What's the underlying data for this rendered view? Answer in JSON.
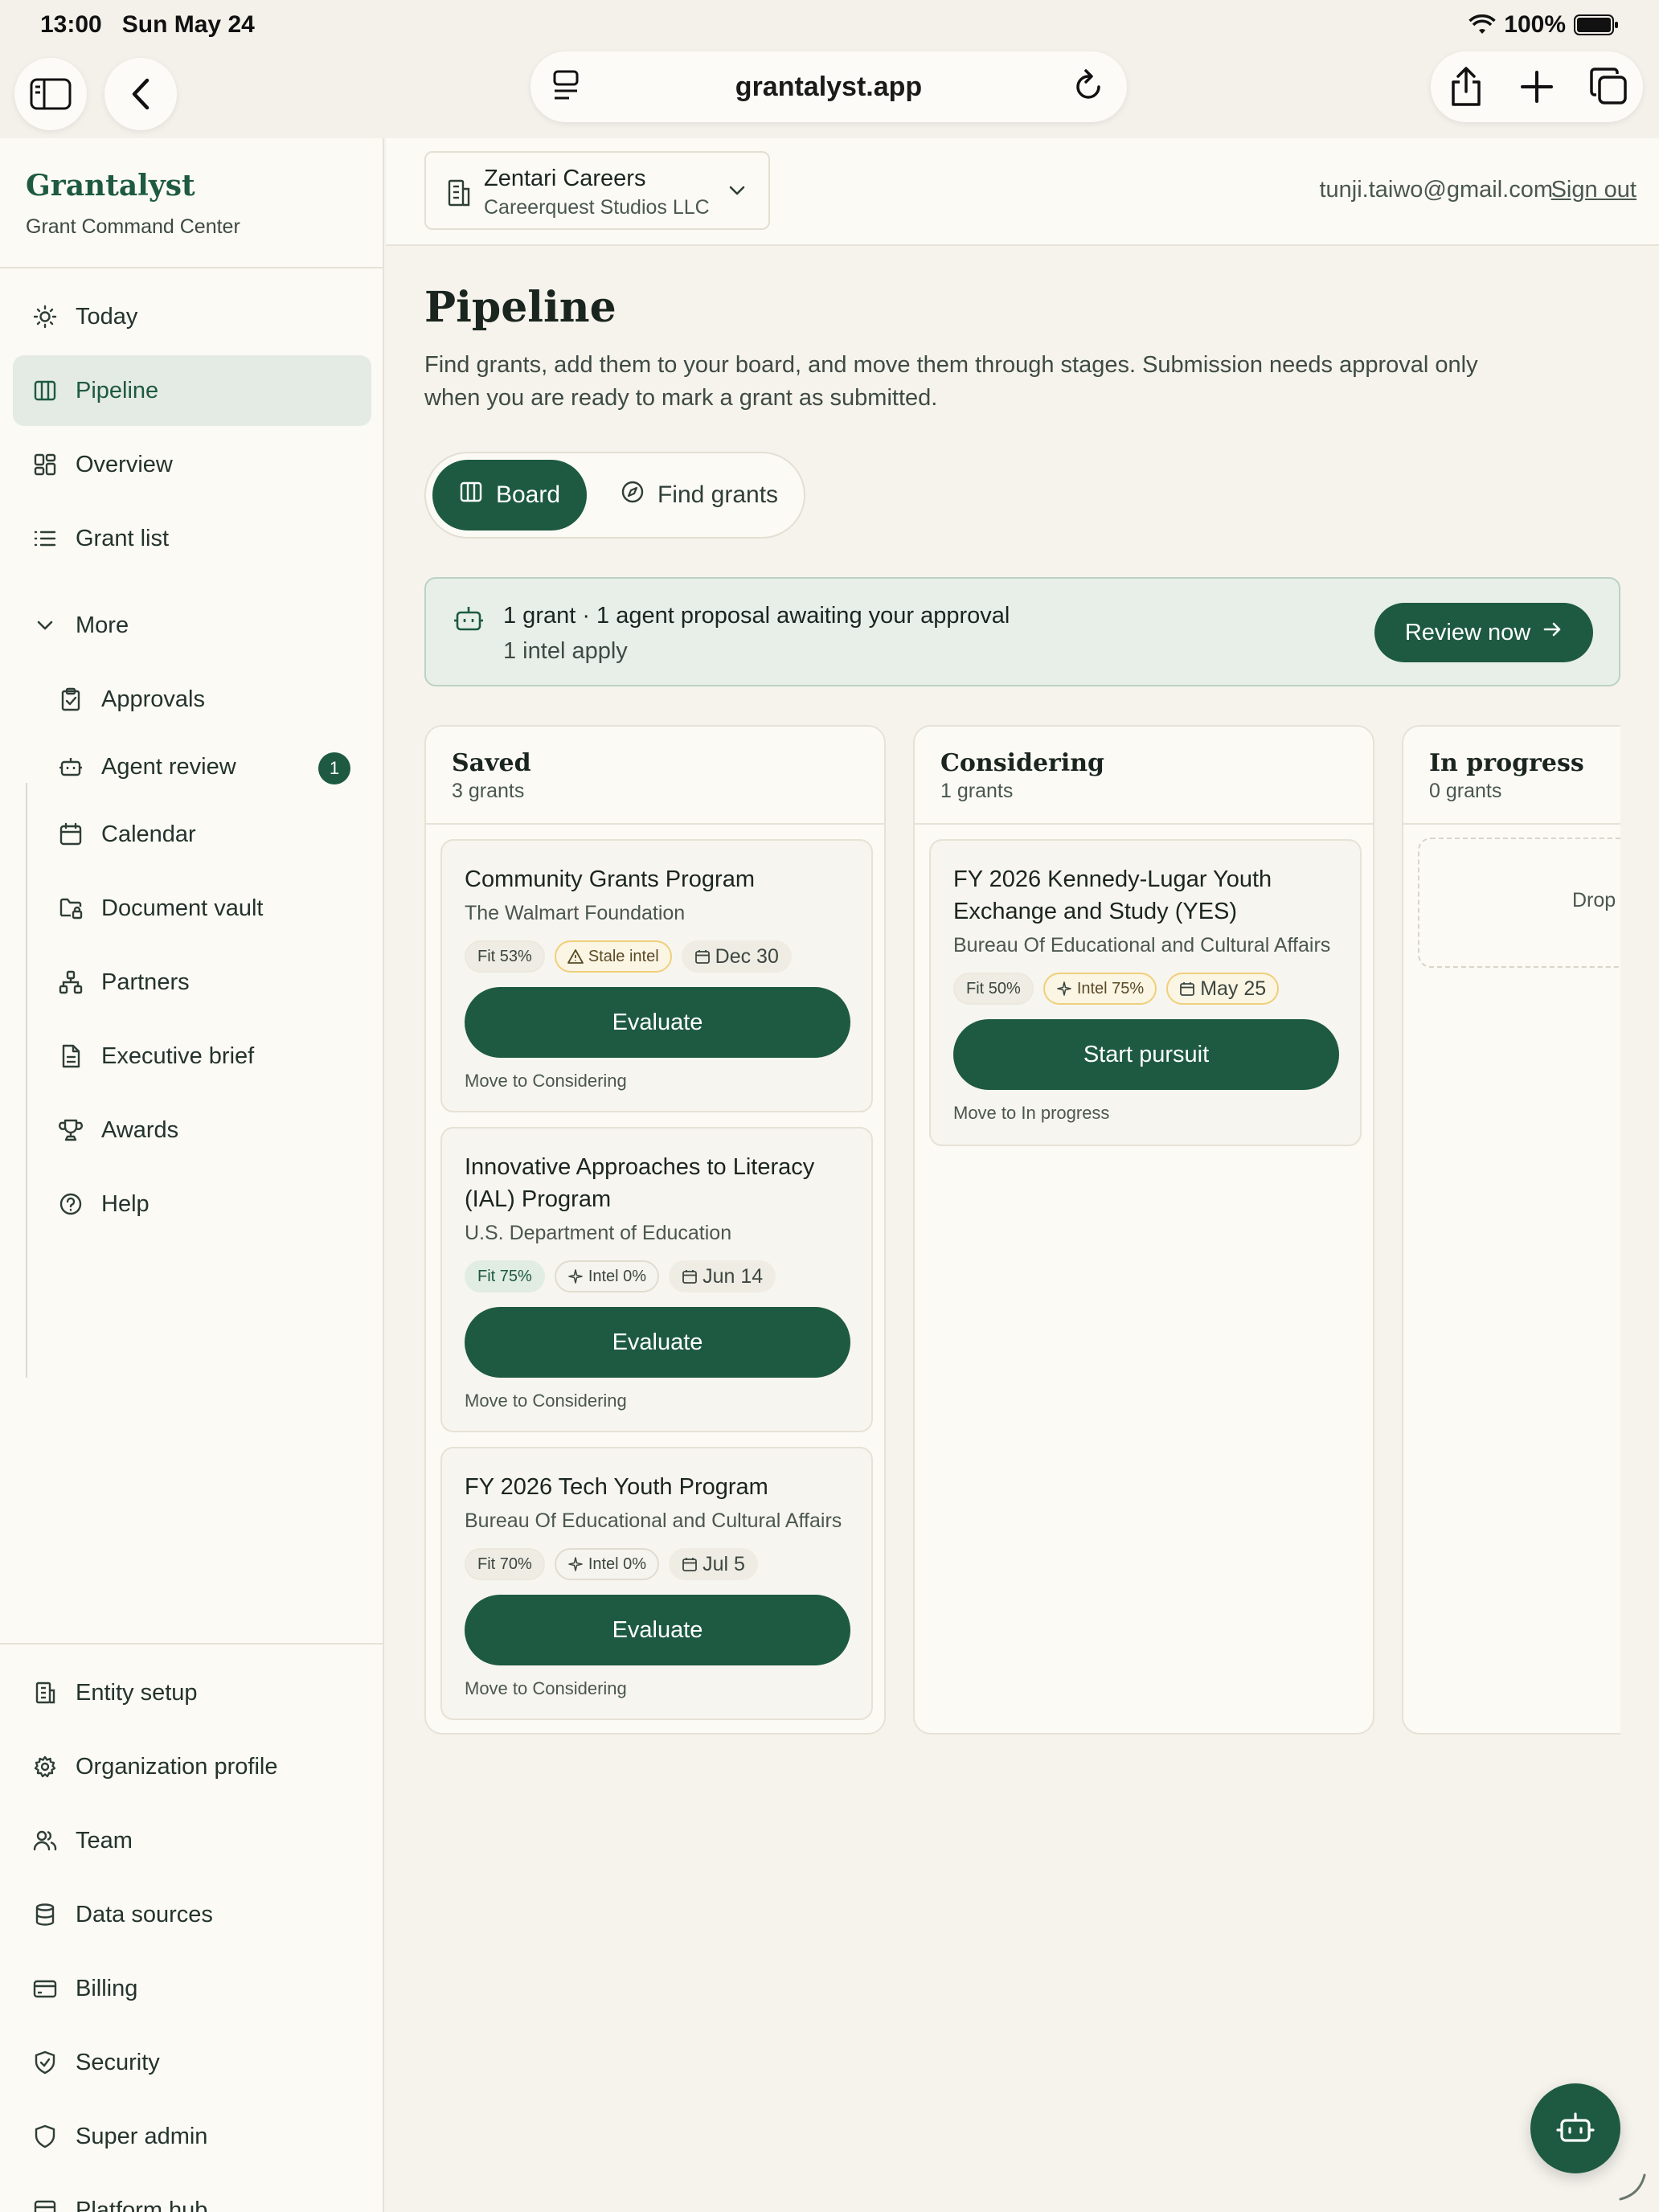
{
  "status_bar": {
    "time": "13:00",
    "date": "Sun May 24",
    "battery": "100%"
  },
  "browser": {
    "url": "grantalyst.app",
    "icons": [
      "sidebar-toggle-icon",
      "back-icon",
      "page-menu-icon",
      "reload-icon",
      "share-icon",
      "new-tab-icon",
      "tabs-icon"
    ]
  },
  "sidebar": {
    "brand": "Grantalyst",
    "brand_sub": "Grant Command Center",
    "nav": [
      {
        "label": "Today",
        "icon": "sun-icon"
      },
      {
        "label": "Pipeline",
        "icon": "columns-icon",
        "active": true
      },
      {
        "label": "Overview",
        "icon": "dashboard-icon"
      },
      {
        "label": "Grant list",
        "icon": "list-icon"
      }
    ],
    "more_label": "More",
    "more_items": [
      {
        "label": "Approvals",
        "icon": "clipboard-check-icon"
      },
      {
        "label": "Agent review",
        "icon": "robot-icon",
        "badge": "1"
      },
      {
        "label": "Calendar",
        "icon": "calendar-icon"
      },
      {
        "label": "Document vault",
        "icon": "folder-lock-icon"
      },
      {
        "label": "Partners",
        "icon": "network-icon"
      },
      {
        "label": "Executive brief",
        "icon": "document-icon"
      },
      {
        "label": "Awards",
        "icon": "trophy-icon"
      },
      {
        "label": "Help",
        "icon": "help-circle-icon"
      }
    ],
    "bottom": [
      {
        "label": "Entity setup",
        "icon": "building-icon"
      },
      {
        "label": "Organization profile",
        "icon": "gear-icon"
      },
      {
        "label": "Team",
        "icon": "users-icon"
      },
      {
        "label": "Data sources",
        "icon": "database-icon"
      },
      {
        "label": "Billing",
        "icon": "credit-card-icon"
      },
      {
        "label": "Security",
        "icon": "shield-check-icon"
      },
      {
        "label": "Super admin",
        "icon": "shield-icon"
      },
      {
        "label": "Platform hub",
        "icon": "hub-icon"
      }
    ]
  },
  "topbar": {
    "org_name": "Zentari Careers",
    "org_sub": "Careerquest Studios LLC",
    "email": "tunji.taiwo@gmail.com",
    "sign_out": "Sign out"
  },
  "page": {
    "title": "Pipeline",
    "description": "Find grants, add them to your board, and move them through stages. Submission needs approval only when you are ready to mark a grant as submitted.",
    "tabs": {
      "board": "Board",
      "find": "Find grants"
    }
  },
  "approval": {
    "title": "1 grant · 1 agent proposal awaiting your approval",
    "sub": "1 intel apply",
    "button": "Review now"
  },
  "columns": [
    {
      "title": "Saved",
      "count": "3 grants",
      "cards": [
        {
          "title": "Community Grants Program",
          "org": "The Walmart Foundation",
          "fit": "Fit 53%",
          "intel": "Stale intel",
          "date": "Dec 30",
          "action": "Evaluate",
          "move": "Move to Considering"
        },
        {
          "title": "Innovative Approaches to Literacy (IAL) Program",
          "org": "U.S. Department of Education",
          "fit": "Fit 75%",
          "intel": "Intel 0%",
          "date": "Jun 14",
          "action": "Evaluate",
          "move": "Move to Considering"
        },
        {
          "title": "FY 2026 Tech Youth Program",
          "org": "Bureau Of Educational and Cultural Affairs",
          "fit": "Fit 70%",
          "intel": "Intel 0%",
          "date": "Jul 5",
          "action": "Evaluate",
          "move": "Move to Considering"
        }
      ]
    },
    {
      "title": "Considering",
      "count": "1 grants",
      "cards": [
        {
          "title": "FY 2026 Kennedy-Lugar Youth Exchange and Study (YES)",
          "org": "Bureau Of Educational and Cultural Affairs",
          "fit": "Fit 50%",
          "intel": "Intel 75%",
          "date": "May 25",
          "action": "Start pursuit",
          "move": "Move to In progress"
        }
      ]
    },
    {
      "title": "In progress",
      "count": "0 grants",
      "drop_text": "Drop grants here"
    }
  ],
  "colors": {
    "accent": "#1d5a41",
    "background": "#f5f3ec",
    "warning_border": "#efcf7a"
  }
}
